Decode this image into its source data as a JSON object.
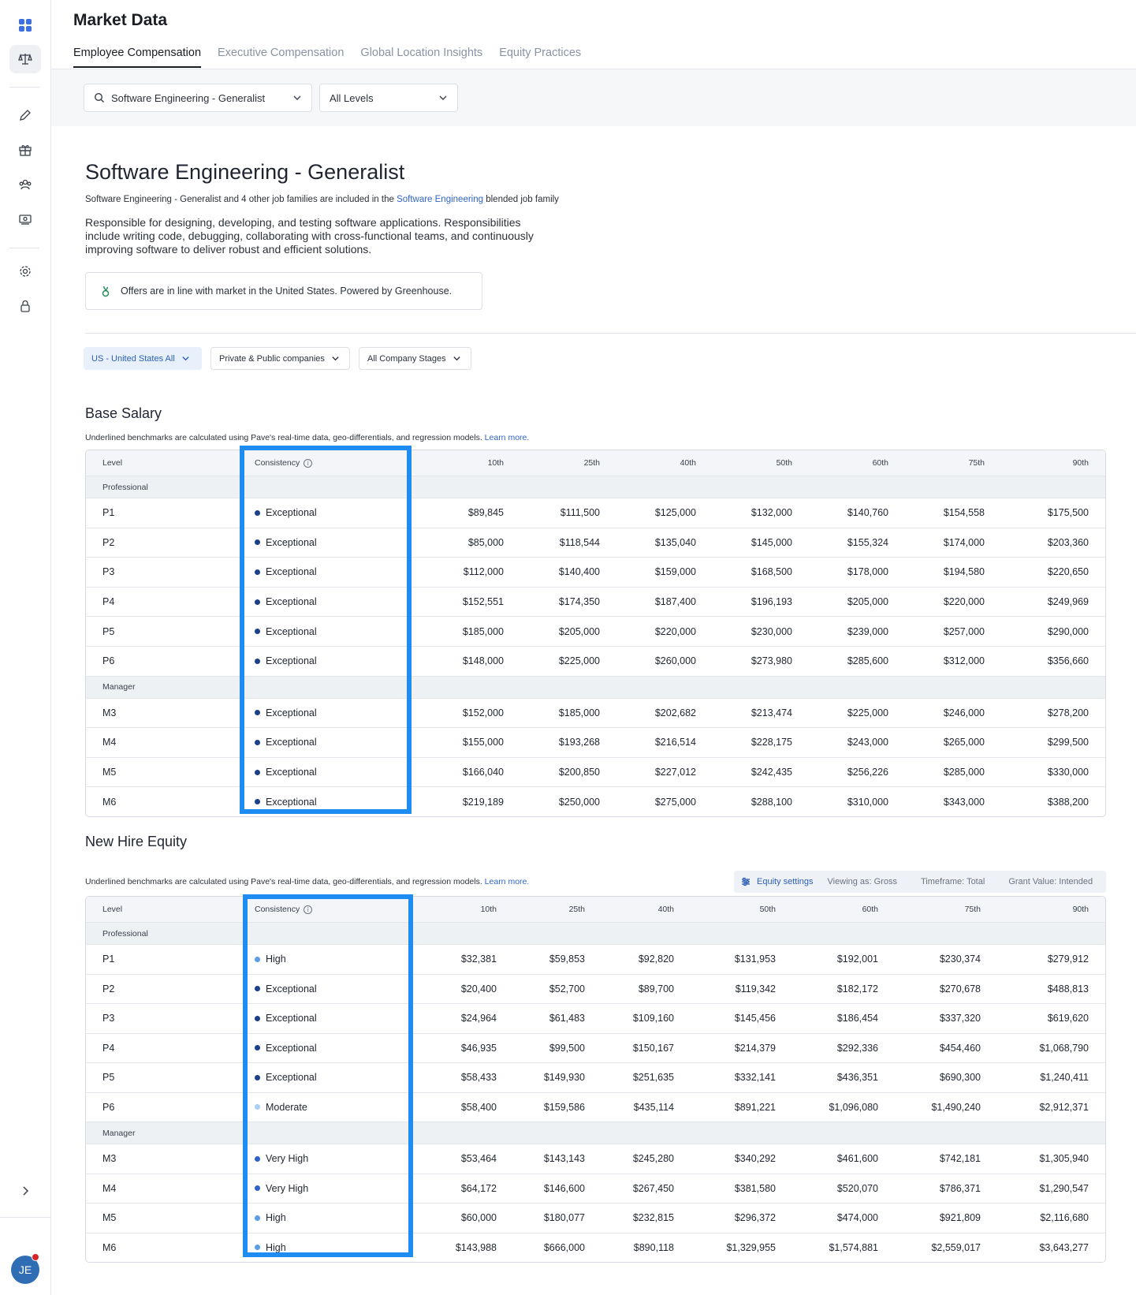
{
  "header": {
    "title": "Market Data",
    "tabs": [
      {
        "label": "Employee Compensation",
        "active": true
      },
      {
        "label": "Executive Compensation",
        "active": false
      },
      {
        "label": "Global Location Insights",
        "active": false
      },
      {
        "label": "Equity Practices",
        "active": false
      }
    ]
  },
  "filters": {
    "job_family": "Software Engineering - Generalist",
    "levels": "All Levels"
  },
  "job": {
    "title": "Software Engineering - Generalist",
    "subtitle_pre": "Software Engineering - Generalist and 4 other job families are included in the ",
    "subtitle_link": "Software Engineering",
    "subtitle_post": " blended job family",
    "description": "Responsible for designing, developing, and testing software applications. Responsibilities include writing code, debugging, collaborating with cross-functional teams, and continuously improving software to deliver robust and efficient solutions.",
    "notice": "Offers are in line with market in the United States. Powered by Greenhouse."
  },
  "chips": {
    "location": "US - United States All",
    "company_type": "Private & Public companies",
    "company_stage": "All Company Stages"
  },
  "colors": {
    "highlight": "#1e8cf0",
    "exceptional": "#1c3f8c",
    "very_high": "#2f64c7",
    "high": "#5b9de8",
    "moderate": "#a9cff5"
  },
  "base_salary": {
    "title": "Base Salary",
    "note": "Underlined benchmarks are calculated using Pave's real-time data, geo-differentials, and regression models.",
    "learn_more": "Learn more.",
    "headers": [
      "Level",
      "Consistency",
      "10th",
      "25th",
      "40th",
      "50th",
      "60th",
      "75th",
      "90th"
    ],
    "groups": [
      {
        "name": "Professional",
        "rows": [
          {
            "level": "P1",
            "consistency": "Exceptional",
            "values": [
              "$89,845",
              "$111,500",
              "$125,000",
              "$132,000",
              "$140,760",
              "$154,558",
              "$175,500"
            ]
          },
          {
            "level": "P2",
            "consistency": "Exceptional",
            "values": [
              "$85,000",
              "$118,544",
              "$135,040",
              "$145,000",
              "$155,324",
              "$174,000",
              "$203,360"
            ]
          },
          {
            "level": "P3",
            "consistency": "Exceptional",
            "values": [
              "$112,000",
              "$140,400",
              "$159,000",
              "$168,500",
              "$178,000",
              "$194,580",
              "$220,650"
            ]
          },
          {
            "level": "P4",
            "consistency": "Exceptional",
            "values": [
              "$152,551",
              "$174,350",
              "$187,400",
              "$196,193",
              "$205,000",
              "$220,000",
              "$249,969"
            ]
          },
          {
            "level": "P5",
            "consistency": "Exceptional",
            "values": [
              "$185,000",
              "$205,000",
              "$220,000",
              "$230,000",
              "$239,000",
              "$257,000",
              "$290,000"
            ]
          },
          {
            "level": "P6",
            "consistency": "Exceptional",
            "values": [
              "$148,000",
              "$225,000",
              "$260,000",
              "$273,980",
              "$285,600",
              "$312,000",
              "$356,660"
            ]
          }
        ]
      },
      {
        "name": "Manager",
        "rows": [
          {
            "level": "M3",
            "consistency": "Exceptional",
            "values": [
              "$152,000",
              "$185,000",
              "$202,682",
              "$213,474",
              "$225,000",
              "$246,000",
              "$278,200"
            ]
          },
          {
            "level": "M4",
            "consistency": "Exceptional",
            "values": [
              "$155,000",
              "$193,268",
              "$216,514",
              "$228,175",
              "$243,000",
              "$265,000",
              "$299,500"
            ]
          },
          {
            "level": "M5",
            "consistency": "Exceptional",
            "values": [
              "$166,040",
              "$200,850",
              "$227,012",
              "$242,435",
              "$256,226",
              "$285,000",
              "$330,000"
            ]
          },
          {
            "level": "M6",
            "consistency": "Exceptional",
            "values": [
              "$219,189",
              "$250,000",
              "$275,000",
              "$288,100",
              "$310,000",
              "$343,000",
              "$388,200"
            ]
          }
        ]
      }
    ]
  },
  "new_hire_equity": {
    "title": "New Hire Equity",
    "note": "Underlined benchmarks are calculated using Pave's real-time data, geo-differentials, and regression models.",
    "learn_more": "Learn more.",
    "settings": {
      "link": "Equity settings",
      "viewing": "Viewing as: Gross",
      "timeframe": "Timeframe: Total",
      "grant_value": "Grant Value: Intended"
    },
    "headers": [
      "Level",
      "Consistency",
      "10th",
      "25th",
      "40th",
      "50th",
      "60th",
      "75th",
      "90th"
    ],
    "groups": [
      {
        "name": "Professional",
        "rows": [
          {
            "level": "P1",
            "consistency": "High",
            "values": [
              "$32,381",
              "$59,853",
              "$92,820",
              "$131,953",
              "$192,001",
              "$230,374",
              "$279,912"
            ]
          },
          {
            "level": "P2",
            "consistency": "Exceptional",
            "values": [
              "$20,400",
              "$52,700",
              "$89,700",
              "$119,342",
              "$182,172",
              "$270,678",
              "$488,813"
            ]
          },
          {
            "level": "P3",
            "consistency": "Exceptional",
            "values": [
              "$24,964",
              "$61,483",
              "$109,160",
              "$145,456",
              "$186,454",
              "$337,320",
              "$619,620"
            ]
          },
          {
            "level": "P4",
            "consistency": "Exceptional",
            "values": [
              "$46,935",
              "$99,500",
              "$150,167",
              "$214,379",
              "$292,336",
              "$454,460",
              "$1,068,790"
            ]
          },
          {
            "level": "P5",
            "consistency": "Exceptional",
            "values": [
              "$58,433",
              "$149,930",
              "$251,635",
              "$332,141",
              "$436,351",
              "$690,300",
              "$1,240,411"
            ]
          },
          {
            "level": "P6",
            "consistency": "Moderate",
            "values": [
              "$58,400",
              "$159,586",
              "$435,114",
              "$891,221",
              "$1,096,080",
              "$1,490,240",
              "$2,912,371"
            ]
          }
        ]
      },
      {
        "name": "Manager",
        "rows": [
          {
            "level": "M3",
            "consistency": "Very High",
            "values": [
              "$53,464",
              "$143,143",
              "$245,280",
              "$340,292",
              "$461,600",
              "$742,181",
              "$1,305,940"
            ]
          },
          {
            "level": "M4",
            "consistency": "Very High",
            "values": [
              "$64,172",
              "$146,600",
              "$267,450",
              "$381,580",
              "$520,070",
              "$786,371",
              "$1,290,547"
            ]
          },
          {
            "level": "M5",
            "consistency": "High",
            "values": [
              "$60,000",
              "$180,077",
              "$232,815",
              "$296,372",
              "$474,000",
              "$921,809",
              "$2,116,680"
            ]
          },
          {
            "level": "M6",
            "consistency": "High",
            "values": [
              "$143,988",
              "$666,000",
              "$890,118",
              "$1,329,955",
              "$1,574,881",
              "$2,559,017",
              "$3,643,277"
            ]
          }
        ]
      }
    ]
  },
  "user": {
    "initials": "JE"
  }
}
